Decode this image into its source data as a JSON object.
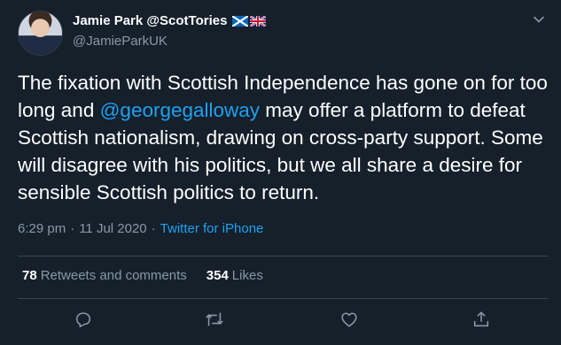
{
  "tweet": {
    "display_name": "Jamie Park @ScotTories",
    "handle": "@JamieParkUK",
    "flags": [
      "scotland-flag",
      "union-jack-flag"
    ],
    "text_before": "The fixation with Scottish Independence has gone on for too long and ",
    "mention": "@georgegalloway",
    "text_after": " may offer a platform to defeat Scottish nationalism, drawing on cross-party support. Some will disagree with his politics, but we all share a desire for sensible Scottish politics to return.",
    "time": "6:29 pm",
    "separator": "·",
    "date": "11 Jul 2020",
    "source": "Twitter for iPhone"
  },
  "stats": {
    "retweets_count": "78",
    "retweets_label": "Retweets and comments",
    "likes_count": "354",
    "likes_label": "Likes"
  },
  "actions": [
    "reply-icon",
    "retweet-icon",
    "like-icon",
    "share-icon"
  ],
  "colors": {
    "background": "#15202b",
    "text": "#ffffff",
    "muted": "#8899a6",
    "accent": "#1da1f2",
    "divider": "#38444d"
  }
}
